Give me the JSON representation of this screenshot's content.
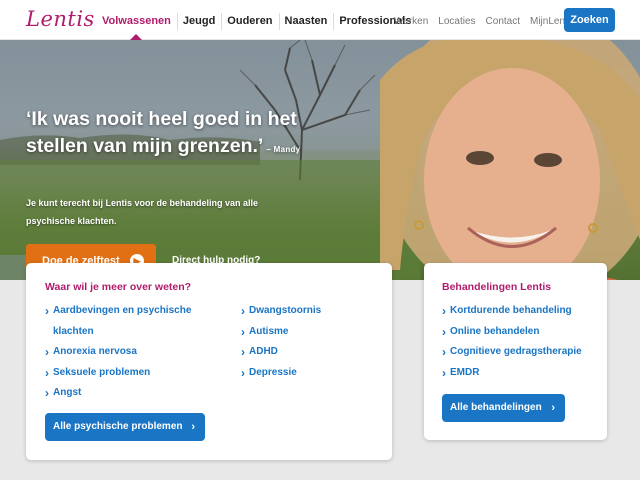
{
  "header": {
    "logo": "Lentis",
    "nav_main": [
      "Volwassenen",
      "Jeugd",
      "Ouderen",
      "Naasten",
      "Professionals"
    ],
    "nav_util": [
      "Werken",
      "Locaties",
      "Contact",
      "MijnLentis"
    ],
    "search_button": "Zoeken"
  },
  "hero": {
    "quote": "‘Ik was nooit heel goed in het stellen van mijn grenzen.’",
    "author": "– Mandy",
    "intro": "Je kunt terecht bij Lentis voor de behandeling van alle psychische klachten.",
    "cta_button": "Doe de zelftest",
    "help_link": "Direct hulp nodig?"
  },
  "card_left": {
    "title": "Waar wil je meer over weten?",
    "col1": [
      "Aardbevingen en psychische klachten",
      "Anorexia nervosa",
      "Seksuele problemen",
      "Angst"
    ],
    "col2": [
      "Dwangstoornis",
      "Autisme",
      "ADHD",
      "Depressie"
    ],
    "button": "Alle psychische problemen"
  },
  "card_right": {
    "title": "Behandelingen Lentis",
    "items": [
      "Kortdurende behandeling",
      "Online behandelen",
      "Cognitieve gedragstherapie",
      "EMDR"
    ],
    "button": "Alle behandelingen"
  },
  "colors": {
    "brand": "#b01c6d",
    "primary": "#1a75c4",
    "cta": "#e07013"
  }
}
